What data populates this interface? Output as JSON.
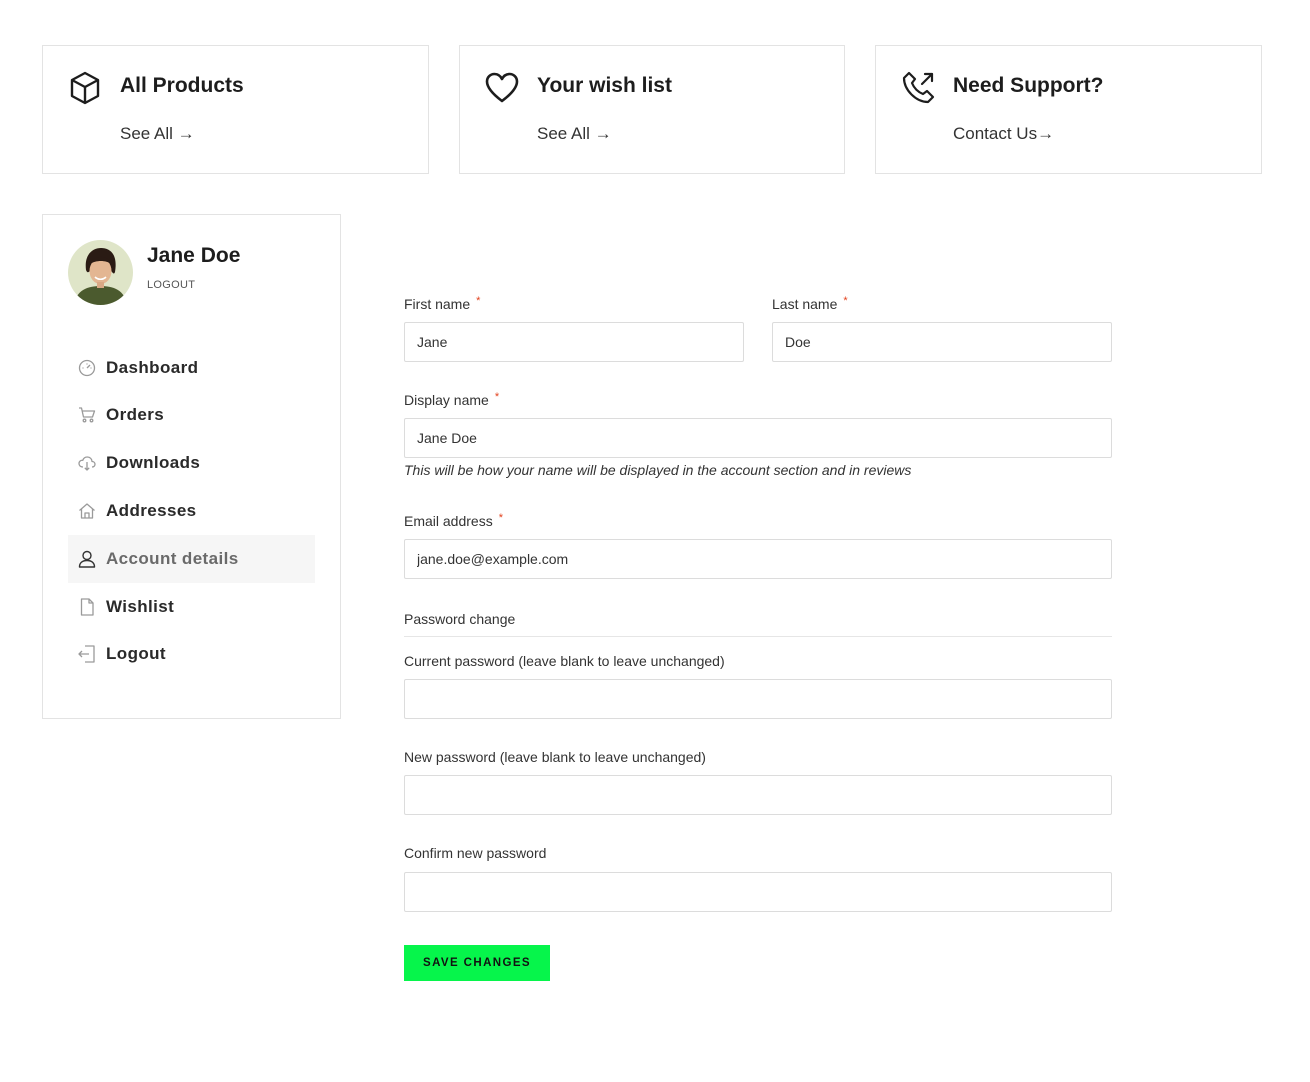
{
  "cards": [
    {
      "icon": "box-icon",
      "title": "All Products",
      "link": "See All →"
    },
    {
      "icon": "heart-icon",
      "title": "Your wish list",
      "link": "See All →"
    },
    {
      "icon": "phone-icon",
      "title": "Need Support?",
      "link": "Contact Us→"
    }
  ],
  "user": {
    "name": "Jane Doe",
    "logout": "LOGOUT"
  },
  "nav": [
    {
      "icon": "dashboard-icon",
      "label": "Dashboard",
      "active": false
    },
    {
      "icon": "cart-icon",
      "label": "Orders",
      "active": false
    },
    {
      "icon": "cloud-download-icon",
      "label": "Downloads",
      "active": false
    },
    {
      "icon": "home-icon",
      "label": "Addresses",
      "active": false
    },
    {
      "icon": "user-icon",
      "label": "Account details",
      "active": true
    },
    {
      "icon": "file-icon",
      "label": "Wishlist",
      "active": false
    },
    {
      "icon": "logout-icon",
      "label": "Logout",
      "active": false
    }
  ],
  "form": {
    "first_name": {
      "label": "First name",
      "required": "*",
      "value": "Jane"
    },
    "last_name": {
      "label": "Last name",
      "required": "*",
      "value": "Doe"
    },
    "display_name": {
      "label": "Display name",
      "required": "*",
      "value": "Jane Doe",
      "help": "This will be how your name will be displayed in the account section and in reviews"
    },
    "email": {
      "label": "Email address",
      "required": "*",
      "value": "jane.doe@example.com"
    },
    "password_section": "Password change",
    "current_password": {
      "label": "Current password (leave blank to leave unchanged)",
      "value": ""
    },
    "new_password": {
      "label": "New password (leave blank to leave unchanged)",
      "value": ""
    },
    "confirm_password": {
      "label": "Confirm new password",
      "value": ""
    },
    "save_label": "SAVE CHANGES"
  },
  "colors": {
    "accent": "#06f54b",
    "required": "#e2401c",
    "border": "#e3e3e3",
    "active_bg": "#f6f6f6"
  }
}
